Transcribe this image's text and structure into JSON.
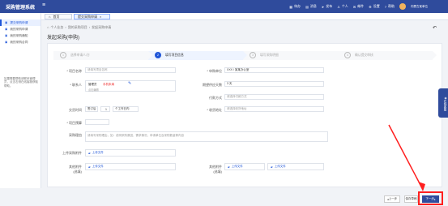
{
  "app": {
    "title": "采购管理系统",
    "menu_toggle": "≡"
  },
  "top": {
    "icons": [
      {
        "name": "tasks-icon",
        "glyph": "▦",
        "label": "待办"
      },
      {
        "name": "notice-icon",
        "glyph": "▤",
        "label": "消息"
      },
      {
        "name": "send-icon",
        "glyph": "➤",
        "label": "发布"
      },
      {
        "name": "user-center-icon",
        "glyph": "♙",
        "label": "个人"
      },
      {
        "name": "mail-icon",
        "glyph": "✉",
        "label": "邮件"
      },
      {
        "name": "settings-icon",
        "glyph": "⚙",
        "label": "设置"
      },
      {
        "name": "help-icon",
        "glyph": "?",
        "label": "帮助"
      }
    ],
    "user": "内蒙古某单位"
  },
  "tabs": [
    {
      "label": "首页",
      "active": false
    },
    {
      "label": "提交采购申请",
      "active": true
    }
  ],
  "sidebar": {
    "items": [
      {
        "label": "提交采购申请",
        "active": true,
        "icon": "▣"
      },
      {
        "label": "我的采购申请",
        "active": false,
        "icon": "▣"
      },
      {
        "label": "我的采购通知",
        "active": false,
        "icon": "▣"
      },
      {
        "label": "我的采购合同",
        "active": false,
        "icon": "▣"
      }
    ],
    "note": "如果需要帮助请联系管理员，点击右侧在线客服获取帮助。"
  },
  "breadcrumb": [
    "个人业务",
    "我的采购项目",
    "发起采购申请"
  ],
  "page_title": "发起采购(申购)",
  "steps": [
    {
      "num": "1",
      "label": "选择申请人/方"
    },
    {
      "num": "2",
      "label": "填写项目信息"
    },
    {
      "num": "3",
      "label": "填写采购明细"
    },
    {
      "num": "4",
      "label": "确认提交审核"
    }
  ],
  "form": {
    "project_name": {
      "label": "* 项目名称",
      "placeholder": "请填写项目名称"
    },
    "purchase_unit": {
      "label": "* 申购单位",
      "value": "XXX / 某某办公室"
    },
    "contact": {
      "label": "* 联系人",
      "value": "管理员",
      "phone": "手机未填",
      "hint": "点击编辑"
    },
    "delivery": {
      "label": "期望供应天数",
      "value": "3 天"
    },
    "payment": {
      "label": "付款方式",
      "placeholder": "请选择付款方式"
    },
    "time": {
      "label": "交货时间",
      "value1": "签订后",
      "value2": "1",
      "unit": "个工作日内"
    },
    "address": {
      "label": "* 收货地址",
      "placeholder": "请选择收货地址"
    },
    "budget": {
      "label": "* 项目预算"
    },
    "notes": {
      "label": "采购理由",
      "placeholder": "请填写采购理由，如：说明采购原因，需求情况，申请单位及采购数量等内容"
    },
    "purchase_file": {
      "label": "上传采购附件",
      "button": "上传文件"
    },
    "other_file": {
      "label": "其他附件\n(选填)",
      "button": "上传文件"
    },
    "attach2": {
      "label": "其他附件\n(选填)",
      "button": "上传文件"
    },
    "attach3": {
      "label": "其他附件\n(选填)",
      "button": "上传文件"
    }
  },
  "buttons": {
    "prev": "上一步",
    "save": "保存草稿",
    "next": "下一步"
  },
  "help": "在线客服"
}
